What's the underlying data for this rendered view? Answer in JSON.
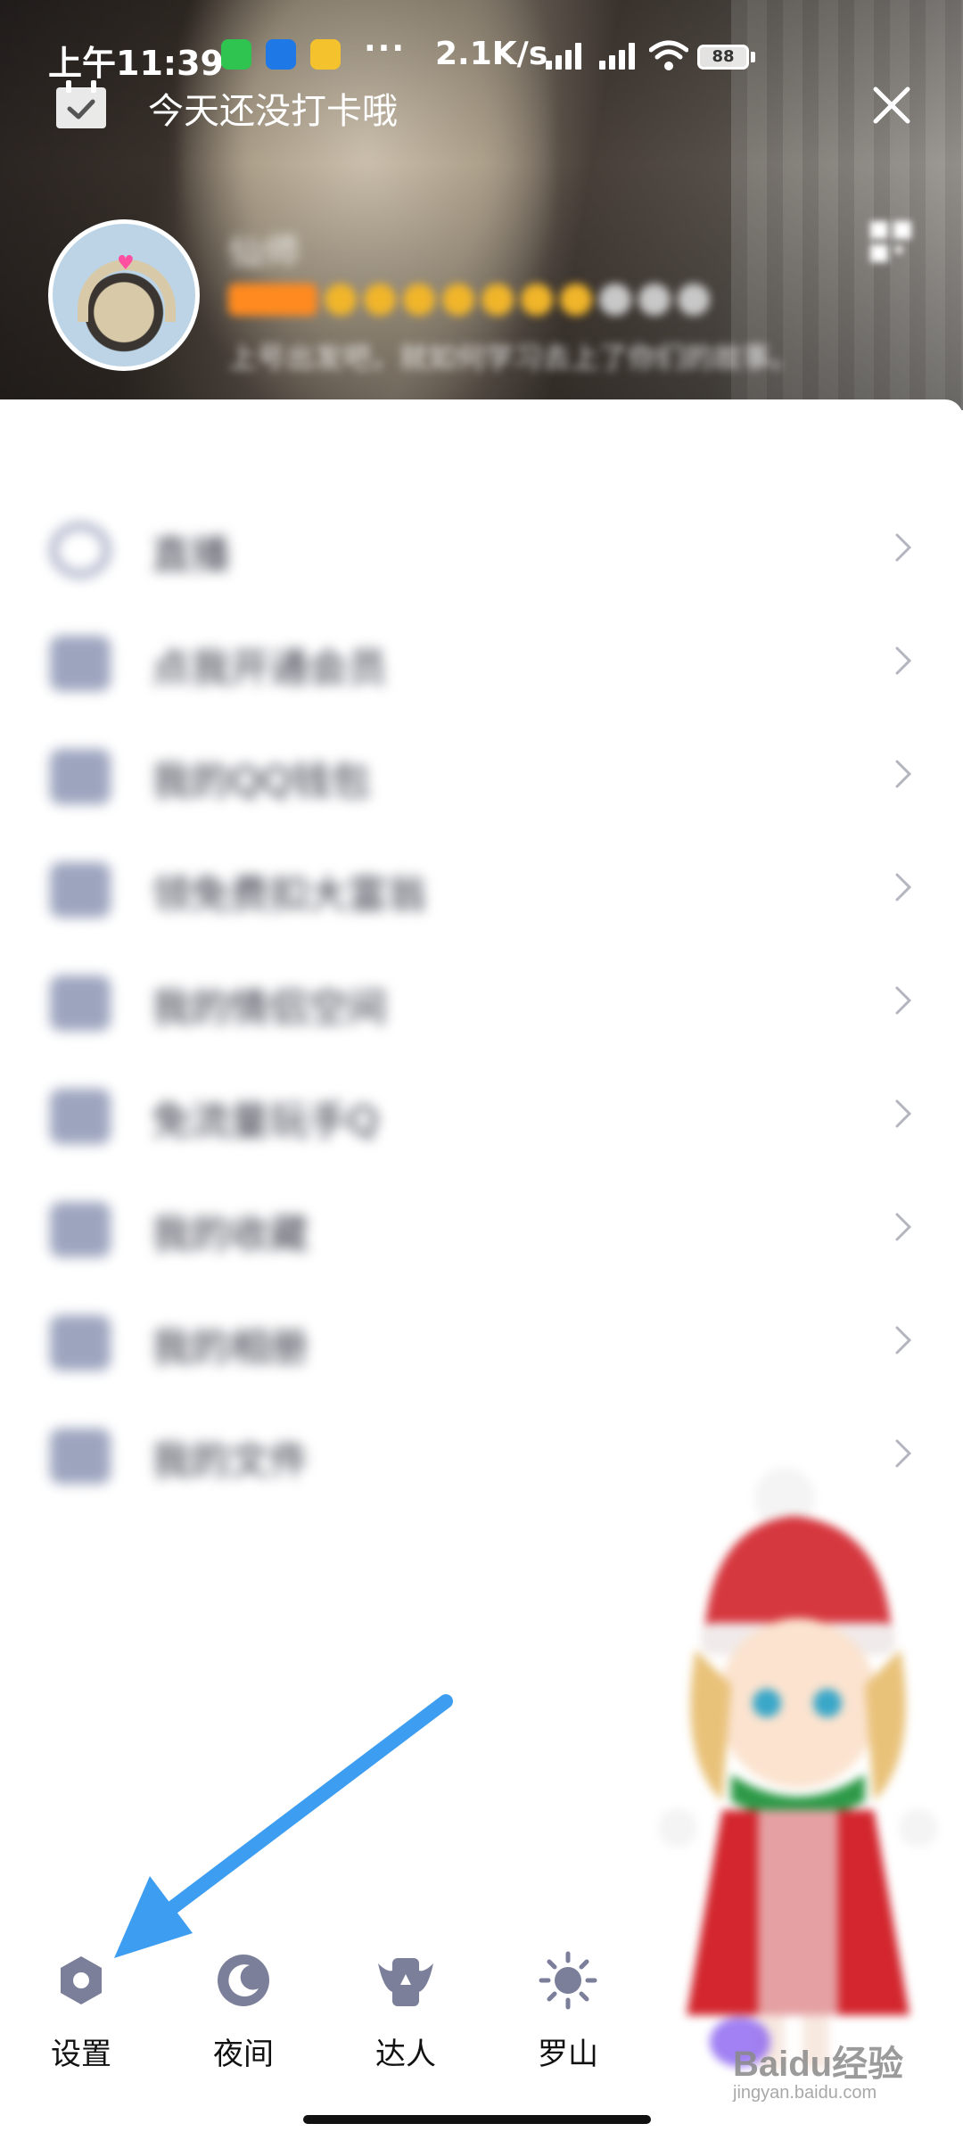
{
  "status_bar": {
    "time": "上午11:39",
    "dots": "···",
    "network_speed": "2.1K/s",
    "battery": "88"
  },
  "header": {
    "checkin_text": "今天还没打卡哦",
    "nickname": "仙师",
    "signature": "上号出发吧，就如何学习去上了你们的故事。"
  },
  "menu": {
    "items": [
      {
        "label": "直播",
        "icon": "live-icon"
      },
      {
        "label": "点我开通会员",
        "icon": "vip-icon"
      },
      {
        "label": "我的QQ钱包",
        "icon": "wallet-icon"
      },
      {
        "label": "领免费扣大富翁",
        "icon": "dress-icon"
      },
      {
        "label": "我的情侣空间",
        "icon": "couple-icon"
      },
      {
        "label": "免流量玩手Q",
        "icon": "flow-icon"
      },
      {
        "label": "我的收藏",
        "icon": "bookmark-icon"
      },
      {
        "label": "我的相册",
        "icon": "album-icon"
      },
      {
        "label": "我的文件",
        "icon": "folder-icon"
      }
    ]
  },
  "bottom_tabs": [
    {
      "label": "设置",
      "icon": "settings-icon"
    },
    {
      "label": "夜间",
      "icon": "moon-icon"
    },
    {
      "label": "达人",
      "icon": "talent-icon"
    },
    {
      "label": "罗山",
      "icon": "weather-sun-icon"
    }
  ],
  "watermark": {
    "top": "Baidu经验",
    "bottom": "jingyan.baidu.com"
  },
  "colors": {
    "accent_arrow": "#3d9df0",
    "icon_gray": "#7b7f99",
    "text_dark": "#111111"
  }
}
